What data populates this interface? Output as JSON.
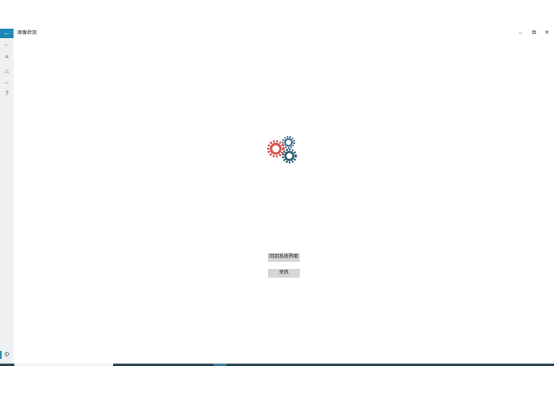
{
  "window": {
    "title": "图像检测",
    "back_glyph": "←",
    "minimize_glyph": "–",
    "restore_glyph": "⧉",
    "close_glyph": "✕"
  },
  "rail": {
    "back_glyph": "←",
    "menu_glyph": "≡",
    "home_glyph": "⌂",
    "connect_glyph": "⇔",
    "help_glyph": "?",
    "settings_glyph": "⚙"
  },
  "main": {
    "gear_colors": {
      "large": "#d9534f",
      "small": "#4f7f95",
      "dark": "#2b5a70"
    },
    "return_button": "回到系统界面",
    "shutdown_button": "关机"
  },
  "colors": {
    "accent": "#1e88b6",
    "taskbar": "#2c4552"
  }
}
